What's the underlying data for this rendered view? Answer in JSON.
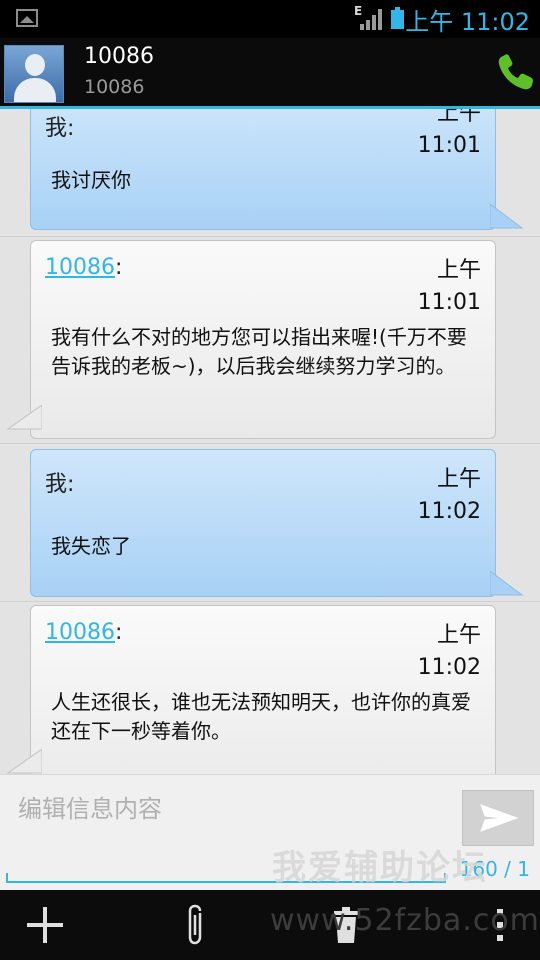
{
  "status_bar": {
    "network_type": "E",
    "time": "上午 11:02"
  },
  "header": {
    "contact_name": "10086",
    "contact_number": "10086"
  },
  "messages": [
    {
      "direction": "outgoing",
      "sender": "我:",
      "time_ampm": "上午",
      "time": "11:01",
      "text": "我讨厌你"
    },
    {
      "direction": "incoming",
      "sender": "10086",
      "sender_suffix": ":",
      "time_ampm": "上午",
      "time": "11:01",
      "text": "我有什么不对的地方您可以指出来喔!(千万不要告诉我的老板~)，以后我会继续努力学习的。"
    },
    {
      "direction": "outgoing",
      "sender": "我:",
      "time_ampm": "上午",
      "time": "11:02",
      "text": "我失恋了"
    },
    {
      "direction": "incoming",
      "sender": "10086",
      "sender_suffix": ":",
      "time_ampm": "上午",
      "time": "11:02",
      "text": "人生还很长，谁也无法预知明天，也许你的真爱还在下一秒等着你。"
    }
  ],
  "composer": {
    "placeholder": "编辑信息内容",
    "counter": "160 / 1"
  },
  "watermark": {
    "title": "我爱辅助论坛",
    "url": "www.52fzba.com"
  },
  "colors": {
    "accent": "#33b5e5",
    "call_green": "#5fbf2a"
  },
  "icons": [
    "image-icon",
    "signal-icon",
    "battery-icon",
    "call-icon",
    "send-icon",
    "add-icon",
    "attach-icon",
    "delete-icon",
    "overflow-menu-icon"
  ]
}
